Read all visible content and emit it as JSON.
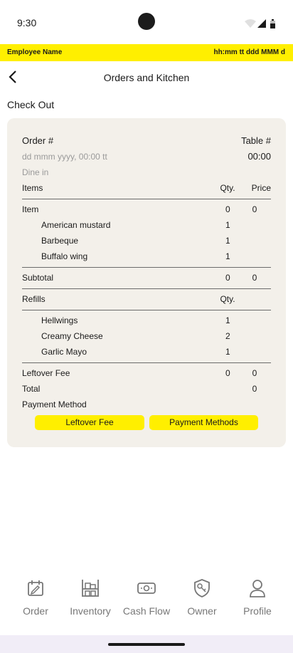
{
  "status_bar": {
    "time": "9:30"
  },
  "employee_bar": {
    "name": "Employee Name",
    "datetime": "hh:mm tt ddd MMM d"
  },
  "header": {
    "title": "Orders and Kitchen"
  },
  "section_title": "Check Out",
  "order": {
    "order_label": "Order #",
    "table_label": "Table #",
    "datetime": "dd mmm yyyy, 00:00 tt",
    "time": "00:00",
    "service_type": "Dine in",
    "items_header": {
      "label": "Items",
      "qty": "Qty.",
      "price": "Price"
    },
    "item": {
      "label": "Item",
      "qty": "0",
      "price": "0"
    },
    "sub_items": [
      {
        "name": "American mustard",
        "qty": "1"
      },
      {
        "name": "Barbeque",
        "qty": "1"
      },
      {
        "name": "Buffalo wing",
        "qty": "1"
      }
    ],
    "subtotal": {
      "label": "Subtotal",
      "qty": "0",
      "price": "0"
    },
    "refills_header": {
      "label": "Refills",
      "qty": "Qty."
    },
    "refills": [
      {
        "name": "Hellwings",
        "qty": "1"
      },
      {
        "name": "Creamy Cheese",
        "qty": "2"
      },
      {
        "name": "Garlic Mayo",
        "qty": "1"
      }
    ],
    "leftover_fee": {
      "label": "Leftover Fee",
      "qty": "0",
      "price": "0"
    },
    "total": {
      "label": "Total",
      "price": "0"
    },
    "payment_method_label": "Payment Method",
    "buttons": {
      "leftover_fee": "Leftover Fee",
      "payment_methods": "Payment Methods"
    }
  },
  "bottom_nav": [
    {
      "label": "Order",
      "icon": "order-icon"
    },
    {
      "label": "Inventory",
      "icon": "inventory-icon"
    },
    {
      "label": "Cash Flow",
      "icon": "cash-flow-icon"
    },
    {
      "label": "Owner",
      "icon": "owner-icon"
    },
    {
      "label": "Profile",
      "icon": "profile-icon"
    }
  ],
  "colors": {
    "accent": "#ffef00",
    "card": "#f3f0ea",
    "nav_label": "#777777"
  }
}
